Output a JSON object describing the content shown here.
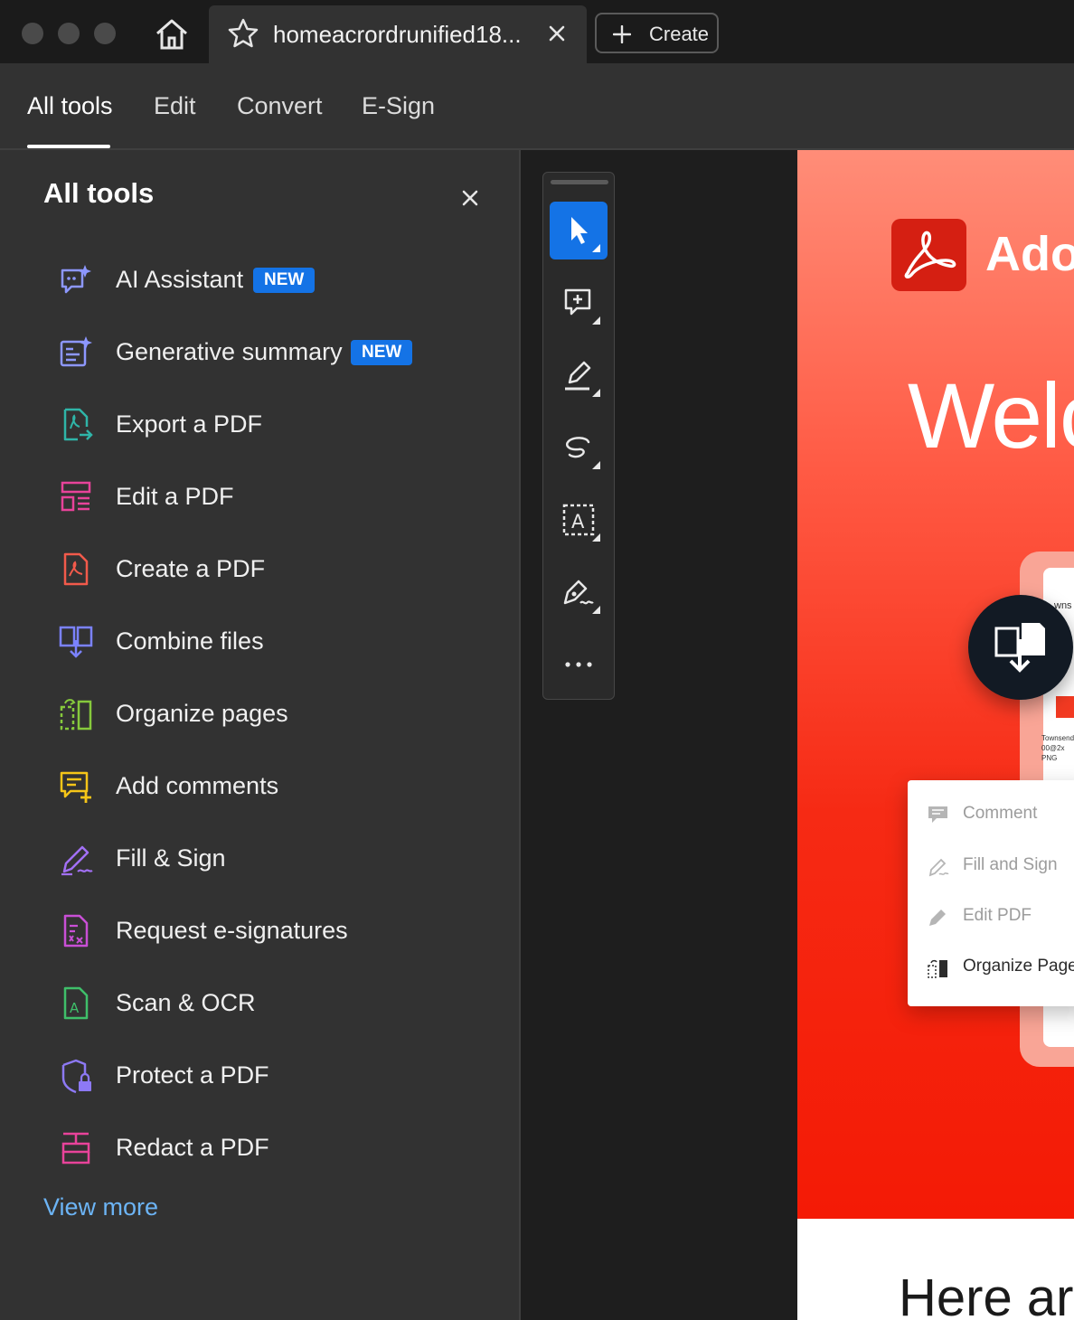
{
  "window": {
    "tab_title": "homeacrordrunified18...",
    "create_label": "Create"
  },
  "toolbar": {
    "tabs": [
      "All tools",
      "Edit",
      "Convert",
      "E-Sign"
    ],
    "active_tab": "All tools"
  },
  "panel": {
    "title": "All tools",
    "tools": [
      {
        "label": "AI Assistant",
        "badge": "NEW",
        "icon": "ai-assistant-icon",
        "color": "#8d97ff"
      },
      {
        "label": "Generative summary",
        "badge": "NEW",
        "icon": "generative-summary-icon",
        "color": "#8d97ff"
      },
      {
        "label": "Export a PDF",
        "icon": "export-pdf-icon",
        "color": "#2fb5a8"
      },
      {
        "label": "Edit a PDF",
        "icon": "edit-pdf-icon",
        "color": "#e8439a"
      },
      {
        "label": "Create a PDF",
        "icon": "create-pdf-icon",
        "color": "#f25a4b"
      },
      {
        "label": "Combine files",
        "icon": "combine-files-icon",
        "color": "#7b82ff"
      },
      {
        "label": "Organize pages",
        "icon": "organize-pages-icon",
        "color": "#86c93c"
      },
      {
        "label": "Add comments",
        "icon": "add-comments-icon",
        "color": "#f5c518"
      },
      {
        "label": "Fill & Sign",
        "icon": "fill-sign-icon",
        "color": "#a270f5"
      },
      {
        "label": "Request e-signatures",
        "icon": "request-esignatures-icon",
        "color": "#c94fd6"
      },
      {
        "label": "Scan & OCR",
        "icon": "scan-ocr-icon",
        "color": "#3fbf6a"
      },
      {
        "label": "Protect a PDF",
        "icon": "protect-pdf-icon",
        "color": "#8d79f5"
      },
      {
        "label": "Redact a PDF",
        "icon": "redact-pdf-icon",
        "color": "#e8439a"
      }
    ],
    "view_more": "View more"
  },
  "quick_tools": [
    "select-icon",
    "add-comment-icon",
    "highlight-icon",
    "draw-icon",
    "text-select-icon",
    "sign-icon",
    "more-icon"
  ],
  "document": {
    "logo_text": "Adol",
    "welcome": "Welc",
    "device_text_top": "wns",
    "device_text_bottom": "Townsend\n00@2x\nPNG",
    "menu": [
      "Comment",
      "Fill and Sign",
      "Edit PDF",
      "Organize Pages"
    ],
    "here": "Here are"
  },
  "colors": {
    "accent": "#1473e6",
    "link": "#6cb4f5",
    "adobe_red": "#d51f12"
  }
}
